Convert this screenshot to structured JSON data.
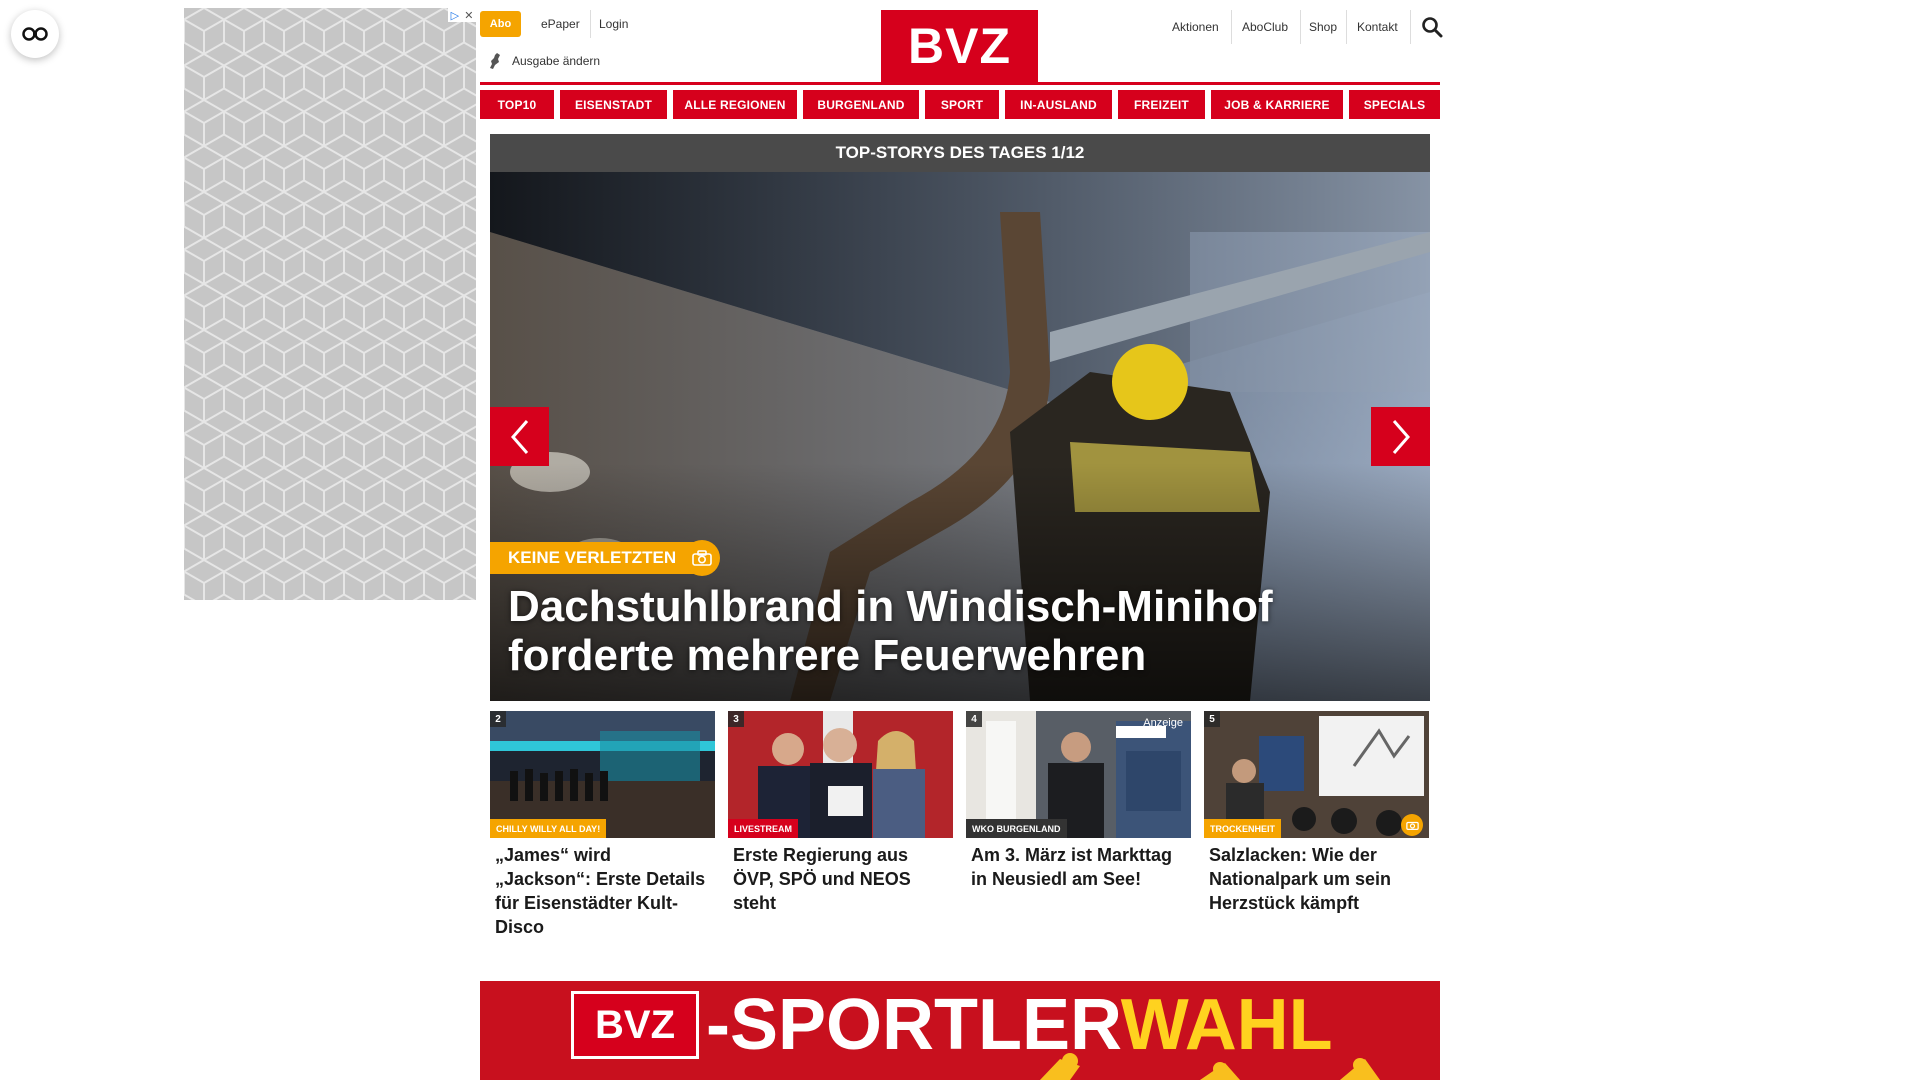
{
  "header": {
    "abo_label": "Abo",
    "epaper_label": "ePaper",
    "login_label": "Login",
    "edition_label": "Ausgabe ändern",
    "logo_text": "BVZ",
    "right_links": [
      "Aktionen",
      "AboClub",
      "Shop",
      "Kontakt"
    ]
  },
  "nav": {
    "items": [
      "TOP10",
      "EISENSTADT",
      "ALLE REGIONEN",
      "BURGENLAND",
      "SPORT",
      "IN-AUSLAND",
      "FREIZEIT",
      "JOB & KARRIERE",
      "SPECIALS"
    ]
  },
  "top_story": {
    "header": "TOP-STORYS DES TAGES 1/12",
    "tag": "KEINE VERLETZTEN",
    "title": "Dachstuhlbrand in Windisch-Minihof forderte mehrere Feuerwehren",
    "tag_color": "#f5a400"
  },
  "cards": [
    {
      "num": "2",
      "tag": "CHILLY WILLY ALL DAY!",
      "tag_color": "#f5a400",
      "title": "„James“ wird „Jackson“: Erste Details für Eisenstädter Kult-Disco"
    },
    {
      "num": "3",
      "tag": "LIVESTREAM",
      "tag_color": "#d6001c",
      "title": "Erste Regierung aus ÖVP, SPÖ und NEOS steht"
    },
    {
      "num": "4",
      "tag": "WKO BURGENLAND",
      "tag_color": "#333333",
      "title": "Am 3. März ist Markttag in Neusiedl am See!",
      "badge": "Anzeige"
    },
    {
      "num": "5",
      "tag": "TROCKENHEIT",
      "tag_color": "#f5a400",
      "title": "Salzlacken: Wie der Nationalpark um sein Herzstück kämpft"
    }
  ],
  "banner": {
    "logo_text": "BVZ",
    "text_main": "-SPORTLER",
    "text_accent": "WAHL"
  },
  "colors": {
    "brand_red": "#d6001c",
    "accent_orange": "#f5a400"
  }
}
